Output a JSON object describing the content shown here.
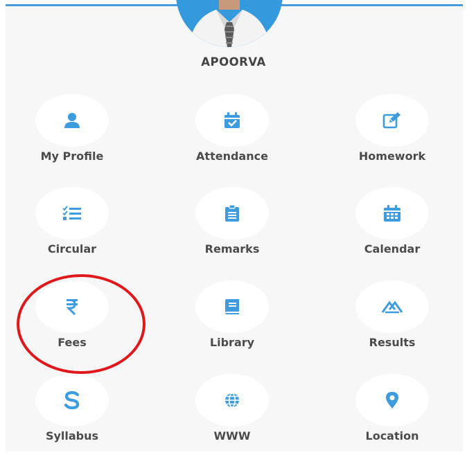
{
  "user": {
    "name": "APOORVA"
  },
  "colors": {
    "accent": "#3d9be0",
    "label": "#4b4b4b",
    "annotation_ring": "#e0181c"
  },
  "menu": [
    {
      "label": "My Profile",
      "icon": "user-icon"
    },
    {
      "label": "Attendance",
      "icon": "calendar-check-icon"
    },
    {
      "label": "Homework",
      "icon": "edit-icon"
    },
    {
      "label": "Circular",
      "icon": "checklist-icon"
    },
    {
      "label": "Remarks",
      "icon": "clipboard-icon"
    },
    {
      "label": "Calendar",
      "icon": "calendar-grid-icon"
    },
    {
      "label": "Fees",
      "icon": "rupee-icon"
    },
    {
      "label": "Library",
      "icon": "book-icon"
    },
    {
      "label": "Results",
      "icon": "results-icon"
    },
    {
      "label": "Syllabus",
      "icon": "s-icon"
    },
    {
      "label": "WWW",
      "icon": "globe-icon"
    },
    {
      "label": "Location",
      "icon": "location-pin-icon"
    }
  ]
}
